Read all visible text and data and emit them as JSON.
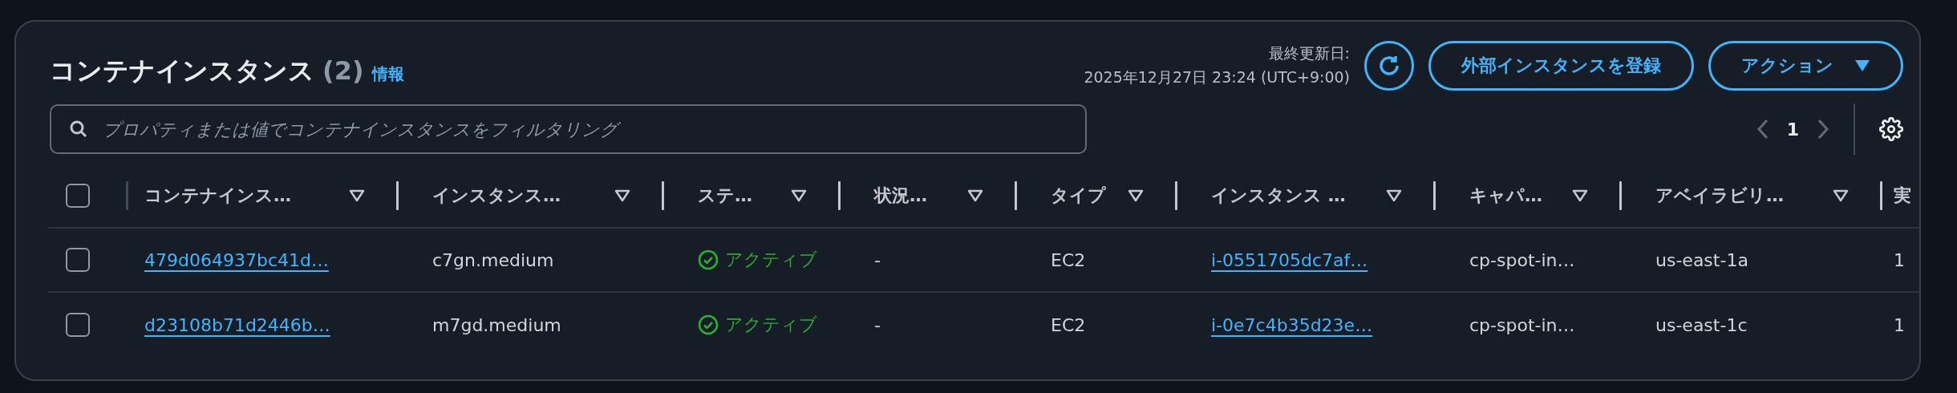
{
  "header": {
    "title": "コンテナインスタンス",
    "count": "(2)",
    "info_link": "情報",
    "last_updated_label": "最終更新日:",
    "last_updated_value": "2025年12月27日 23:24 (UTC+9:00)",
    "buttons": [
      {
        "kind": "refresh"
      },
      {
        "kind": "text",
        "label": "外部インスタンスを登録"
      },
      {
        "kind": "dropdown",
        "label": "アクション"
      }
    ]
  },
  "filter": {
    "placeholder": "プロパティまたは値でコンテナインスタンスをフィルタリング"
  },
  "pagination": {
    "page": "1"
  },
  "table": {
    "select_all": {
      "checked": false
    },
    "columns": [
      {
        "label": "コンテナインス…",
        "filter": true
      },
      {
        "label": "インスタンス…",
        "filter": true
      },
      {
        "label": "ステ…",
        "filter": true
      },
      {
        "label": "状況…",
        "filter": true
      },
      {
        "label": "タイプ",
        "filter": true
      },
      {
        "label": "インスタンス …",
        "filter": true
      },
      {
        "label": "キャパ…",
        "filter": true
      },
      {
        "label": "アベイラビリ…",
        "filter": true
      },
      {
        "label": "実",
        "filter": false
      }
    ],
    "rows": [
      {
        "selected": false,
        "cells": [
          {
            "kind": "link",
            "text": "479d064937bc41d…"
          },
          {
            "kind": "text",
            "text": "c7gn.medium"
          },
          {
            "kind": "status",
            "text": "アクティブ"
          },
          {
            "kind": "text",
            "text": "-"
          },
          {
            "kind": "text",
            "text": "EC2"
          },
          {
            "kind": "link",
            "text": "i-0551705dc7af…"
          },
          {
            "kind": "text",
            "text": "cp-spot-in…"
          },
          {
            "kind": "text",
            "text": "us-east-1a"
          },
          {
            "kind": "text",
            "text": "1"
          }
        ]
      },
      {
        "selected": false,
        "cells": [
          {
            "kind": "link",
            "text": "d23108b71d2446b…"
          },
          {
            "kind": "text",
            "text": "m7gd.medium"
          },
          {
            "kind": "status",
            "text": "アクティブ"
          },
          {
            "kind": "text",
            "text": "-"
          },
          {
            "kind": "text",
            "text": "EC2"
          },
          {
            "kind": "link",
            "text": "i-0e7c4b35d23e…"
          },
          {
            "kind": "text",
            "text": "cp-spot-in…"
          },
          {
            "kind": "text",
            "text": "us-east-1c"
          },
          {
            "kind": "text",
            "text": "1"
          }
        ]
      }
    ]
  }
}
